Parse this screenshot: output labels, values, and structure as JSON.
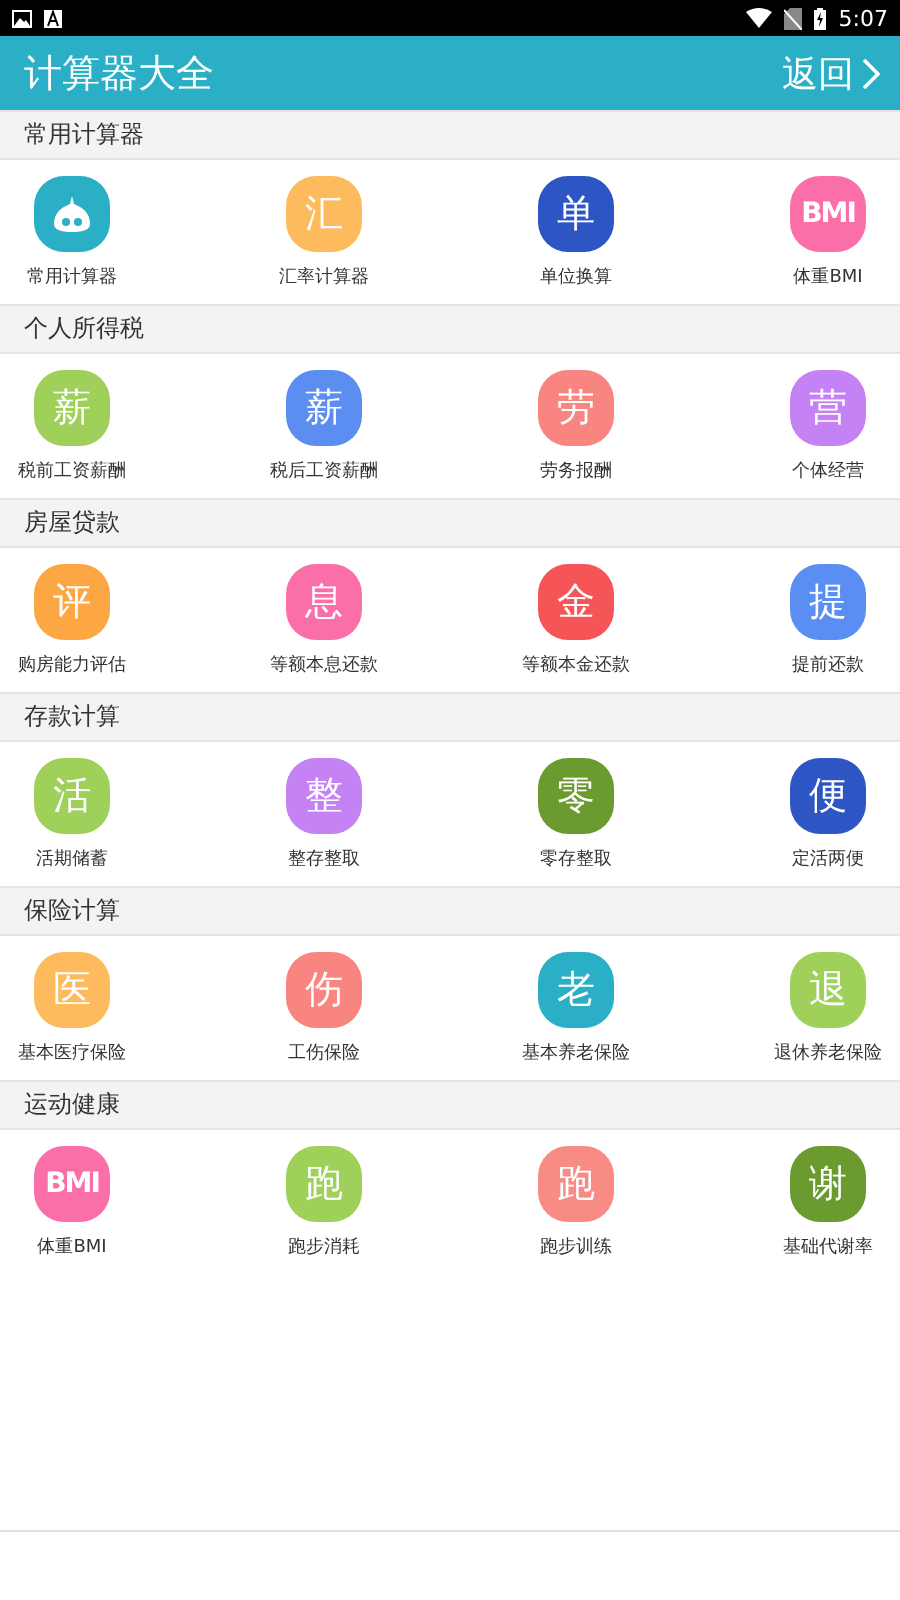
{
  "status_bar": {
    "time": "5:07"
  },
  "header": {
    "title": "计算器大全",
    "back_label": "返回"
  },
  "sections": [
    {
      "title": "常用计算器",
      "items": [
        {
          "kind": "drawing",
          "label": "常用计算器",
          "color": "#2bafc6"
        },
        {
          "kind": "glyph",
          "glyph": "汇",
          "label": "汇率计算器",
          "color": "#fdbb5d"
        },
        {
          "kind": "glyph",
          "glyph": "单",
          "label": "单位换算",
          "color": "#2d55c4"
        },
        {
          "kind": "glyph",
          "glyph": "BMI",
          "label": "体重BMI",
          "color": "#fb6fa9"
        }
      ]
    },
    {
      "title": "个人所得税",
      "items": [
        {
          "kind": "glyph",
          "glyph": "薪",
          "label": "税前工资薪酬",
          "color": "#9fd05a"
        },
        {
          "kind": "glyph",
          "glyph": "薪",
          "label": "税后工资薪酬",
          "color": "#5b8ef0"
        },
        {
          "kind": "glyph",
          "glyph": "劳",
          "label": "劳务报酬",
          "color": "#f8857f"
        },
        {
          "kind": "glyph",
          "glyph": "营",
          "label": "个体经营",
          "color": "#c582f4"
        }
      ]
    },
    {
      "title": "房屋贷款",
      "items": [
        {
          "kind": "glyph",
          "glyph": "评",
          "label": "购房能力评估",
          "color": "#fda744"
        },
        {
          "kind": "glyph",
          "glyph": "息",
          "label": "等额本息还款",
          "color": "#fb6fa9"
        },
        {
          "kind": "glyph",
          "glyph": "金",
          "label": "等额本金还款",
          "color": "#f55556"
        },
        {
          "kind": "glyph",
          "glyph": "提",
          "label": "提前还款",
          "color": "#5a8ef3"
        }
      ]
    },
    {
      "title": "存款计算",
      "items": [
        {
          "kind": "glyph",
          "glyph": "活",
          "label": "活期储蓄",
          "color": "#9fd05a"
        },
        {
          "kind": "glyph",
          "glyph": "整",
          "label": "整存整取",
          "color": "#c582f4"
        },
        {
          "kind": "glyph",
          "glyph": "零",
          "label": "零存整取",
          "color": "#6b9b2f"
        },
        {
          "kind": "glyph",
          "glyph": "便",
          "label": "定活两便",
          "color": "#2d55c4"
        }
      ]
    },
    {
      "title": "保险计算",
      "items": [
        {
          "kind": "glyph",
          "glyph": "医",
          "label": "基本医疗保险",
          "color": "#fdbb5d"
        },
        {
          "kind": "glyph",
          "glyph": "伤",
          "label": "工伤保险",
          "color": "#f8857f"
        },
        {
          "kind": "glyph",
          "glyph": "老",
          "label": "基本养老保险",
          "color": "#2bafc6"
        },
        {
          "kind": "glyph",
          "glyph": "退",
          "label": "退休养老保险",
          "color": "#9fd05a"
        }
      ]
    },
    {
      "title": "运动健康",
      "items": [
        {
          "kind": "glyph",
          "glyph": "BMI",
          "label": "体重BMI",
          "color": "#fb6fa9"
        },
        {
          "kind": "glyph",
          "glyph": "跑",
          "label": "跑步消耗",
          "color": "#9fd05a"
        },
        {
          "kind": "glyph",
          "glyph": "跑",
          "label": "跑步训练",
          "color": "#f88b84"
        },
        {
          "kind": "glyph",
          "glyph": "谢",
          "label": "基础代谢率",
          "color": "#6b9b2f"
        }
      ]
    }
  ]
}
